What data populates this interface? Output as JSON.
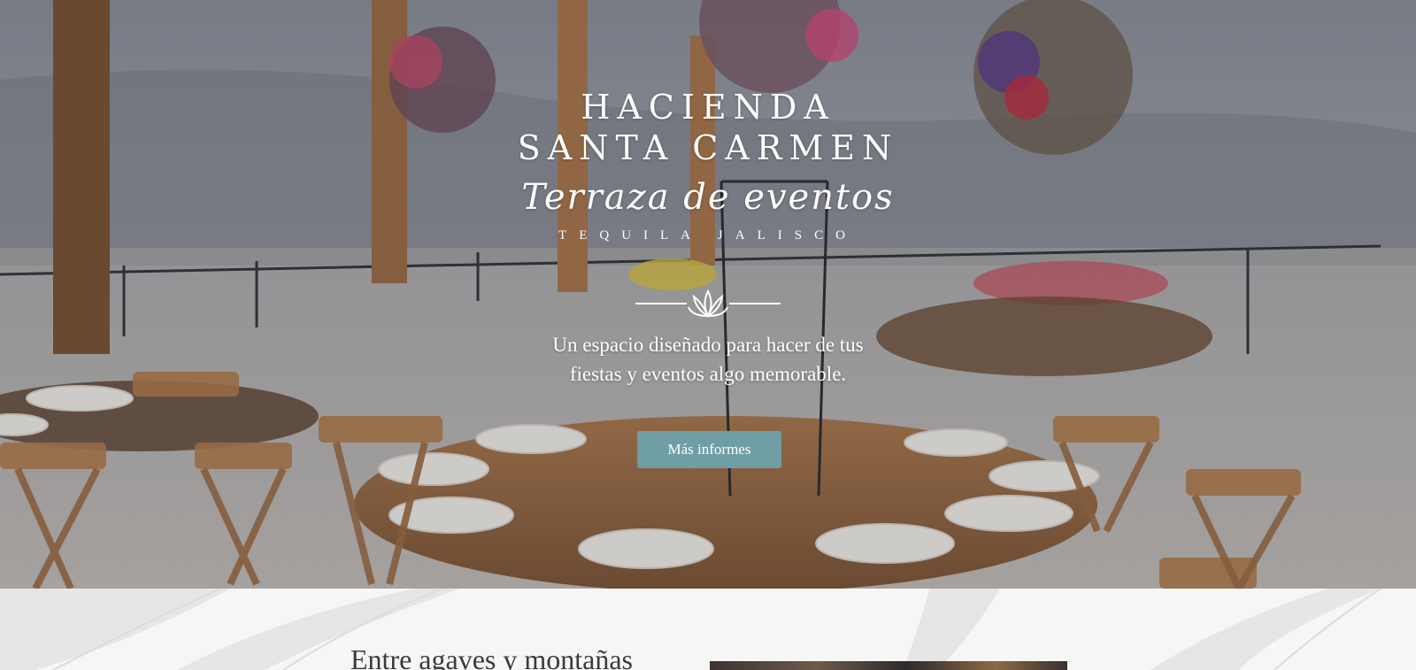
{
  "hero": {
    "title_line1": "HACIENDA",
    "title_line2": "SANTA CARMEN",
    "script": "Terraza de eventos",
    "location": "TEQUILA JALISCO",
    "divider_icon": "agave-icon",
    "tagline_line1": "Un espacio diseñado para hacer de tus",
    "tagline_line2": "fiestas y eventos algo memorable.",
    "cta_label": "Más informes"
  },
  "section": {
    "heading": "Entre agaves y montañas"
  },
  "colors": {
    "cta_background": "#6f9ea4",
    "text_light": "#ffffff",
    "section_background": "#f6f6f6"
  }
}
